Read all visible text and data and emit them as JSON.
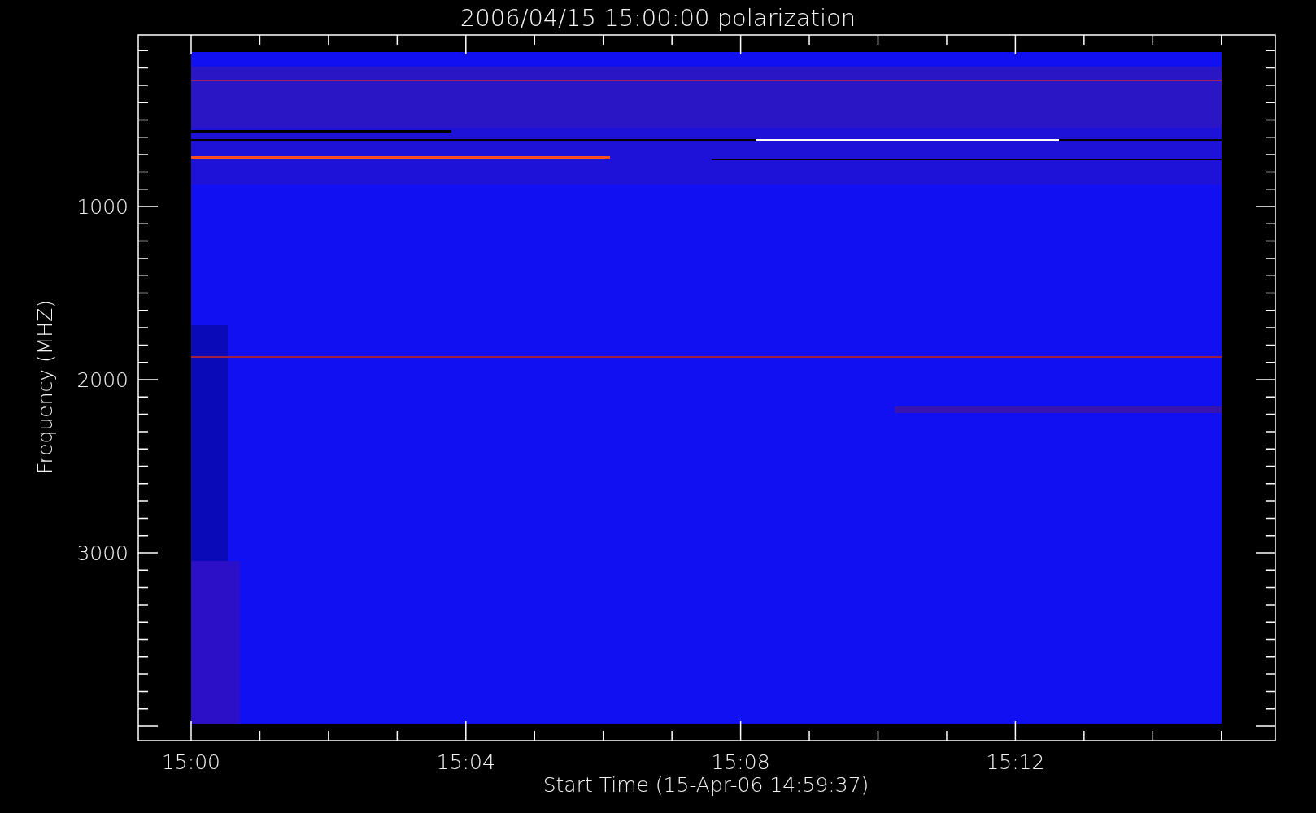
{
  "plot": {
    "title": "2006/04/15 15:00:00 polarization",
    "ylabel": "Frequency (MHZ)",
    "xlabel": "Start Time (15-Apr-06 14:59:37)",
    "yticks": [
      "1000",
      "2000",
      "3000"
    ],
    "xticks": [
      "15:00",
      "15:04",
      "15:08",
      "15:12"
    ]
  }
}
